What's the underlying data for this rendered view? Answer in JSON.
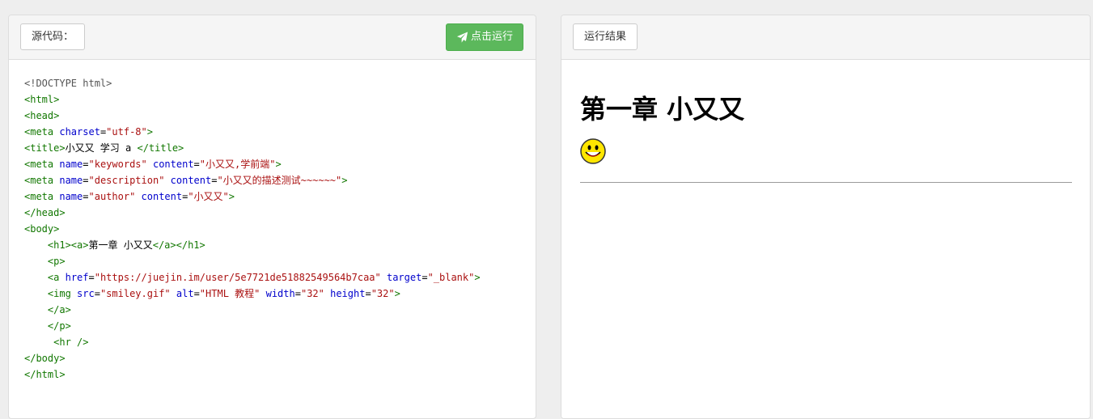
{
  "left_panel": {
    "label": "源代码：",
    "run_button_label": "点击运行",
    "run_button_icon": "paper-plane-icon"
  },
  "right_panel": {
    "label": "运行结果"
  },
  "code_lines": [
    [
      {
        "t": "meta",
        "v": "<!DOCTYPE html>"
      }
    ],
    [
      {
        "t": "tag",
        "v": "<html>"
      }
    ],
    [
      {
        "t": "tag",
        "v": "<head>"
      }
    ],
    [
      {
        "t": "tag",
        "v": "<meta "
      },
      {
        "t": "attr",
        "v": "charset"
      },
      {
        "t": "txt",
        "v": "="
      },
      {
        "t": "str",
        "v": "\"utf-8\""
      },
      {
        "t": "tag",
        "v": ">"
      }
    ],
    [
      {
        "t": "tag",
        "v": "<title>"
      },
      {
        "t": "txt",
        "v": "小又又 学习 a "
      },
      {
        "t": "tag",
        "v": "</title>"
      }
    ],
    [
      {
        "t": "tag",
        "v": "<meta "
      },
      {
        "t": "attr",
        "v": "name"
      },
      {
        "t": "txt",
        "v": "="
      },
      {
        "t": "str",
        "v": "\"keywords\""
      },
      {
        "t": "attr",
        "v": " content"
      },
      {
        "t": "txt",
        "v": "="
      },
      {
        "t": "str",
        "v": "\"小又又,学前端\""
      },
      {
        "t": "tag",
        "v": ">"
      }
    ],
    [
      {
        "t": "tag",
        "v": "<meta "
      },
      {
        "t": "attr",
        "v": "name"
      },
      {
        "t": "txt",
        "v": "="
      },
      {
        "t": "str",
        "v": "\"description\""
      },
      {
        "t": "attr",
        "v": " content"
      },
      {
        "t": "txt",
        "v": "="
      },
      {
        "t": "str",
        "v": "\"小又又的描述测试~~~~~~\""
      },
      {
        "t": "tag",
        "v": ">"
      }
    ],
    [
      {
        "t": "tag",
        "v": "<meta "
      },
      {
        "t": "attr",
        "v": "name"
      },
      {
        "t": "txt",
        "v": "="
      },
      {
        "t": "str",
        "v": "\"author\""
      },
      {
        "t": "attr",
        "v": " content"
      },
      {
        "t": "txt",
        "v": "="
      },
      {
        "t": "str",
        "v": "\"小又又\""
      },
      {
        "t": "tag",
        "v": ">"
      }
    ],
    [
      {
        "t": "tag",
        "v": "</head>"
      }
    ],
    [
      {
        "t": "tag",
        "v": "<body>"
      }
    ],
    [
      {
        "t": "txt",
        "v": "    "
      },
      {
        "t": "tag",
        "v": "<h1><a>"
      },
      {
        "t": "txt",
        "v": "第一章 小又又"
      },
      {
        "t": "tag",
        "v": "</a></h1>"
      }
    ],
    [
      {
        "t": "txt",
        "v": "    "
      },
      {
        "t": "tag",
        "v": "<p>"
      }
    ],
    [
      {
        "t": "txt",
        "v": "    "
      },
      {
        "t": "tag",
        "v": "<a "
      },
      {
        "t": "attr",
        "v": "href"
      },
      {
        "t": "txt",
        "v": "="
      },
      {
        "t": "str",
        "v": "\"https://juejin.im/user/5e7721de51882549564b7caa\""
      },
      {
        "t": "attr",
        "v": " target"
      },
      {
        "t": "txt",
        "v": "="
      },
      {
        "t": "str",
        "v": "\"_blank\""
      },
      {
        "t": "tag",
        "v": ">"
      }
    ],
    [
      {
        "t": "txt",
        "v": "    "
      },
      {
        "t": "tag",
        "v": "<img "
      },
      {
        "t": "attr",
        "v": "src"
      },
      {
        "t": "txt",
        "v": "="
      },
      {
        "t": "str",
        "v": "\"smiley.gif\""
      },
      {
        "t": "attr",
        "v": " alt"
      },
      {
        "t": "txt",
        "v": "="
      },
      {
        "t": "str",
        "v": "\"HTML 教程\""
      },
      {
        "t": "attr",
        "v": " width"
      },
      {
        "t": "txt",
        "v": "="
      },
      {
        "t": "str",
        "v": "\"32\""
      },
      {
        "t": "attr",
        "v": " height"
      },
      {
        "t": "txt",
        "v": "="
      },
      {
        "t": "str",
        "v": "\"32\""
      },
      {
        "t": "tag",
        "v": ">"
      }
    ],
    [
      {
        "t": "txt",
        "v": "    "
      },
      {
        "t": "tag",
        "v": "</a>"
      }
    ],
    [
      {
        "t": "txt",
        "v": "    "
      },
      {
        "t": "tag",
        "v": "</p>"
      }
    ],
    [
      {
        "t": "txt",
        "v": "     "
      },
      {
        "t": "tag",
        "v": "<hr />"
      }
    ],
    [
      {
        "t": "tag",
        "v": "</body>"
      }
    ],
    [
      {
        "t": "tag",
        "v": "</html>"
      }
    ]
  ],
  "result": {
    "heading": "第一章 小又又",
    "image_alt": "HTML 教程",
    "image_icon": "smiley-icon"
  },
  "colors": {
    "run_button": "#5cb85c",
    "code_tag": "#117700",
    "code_attr": "#0000cc",
    "code_string": "#aa1111"
  }
}
